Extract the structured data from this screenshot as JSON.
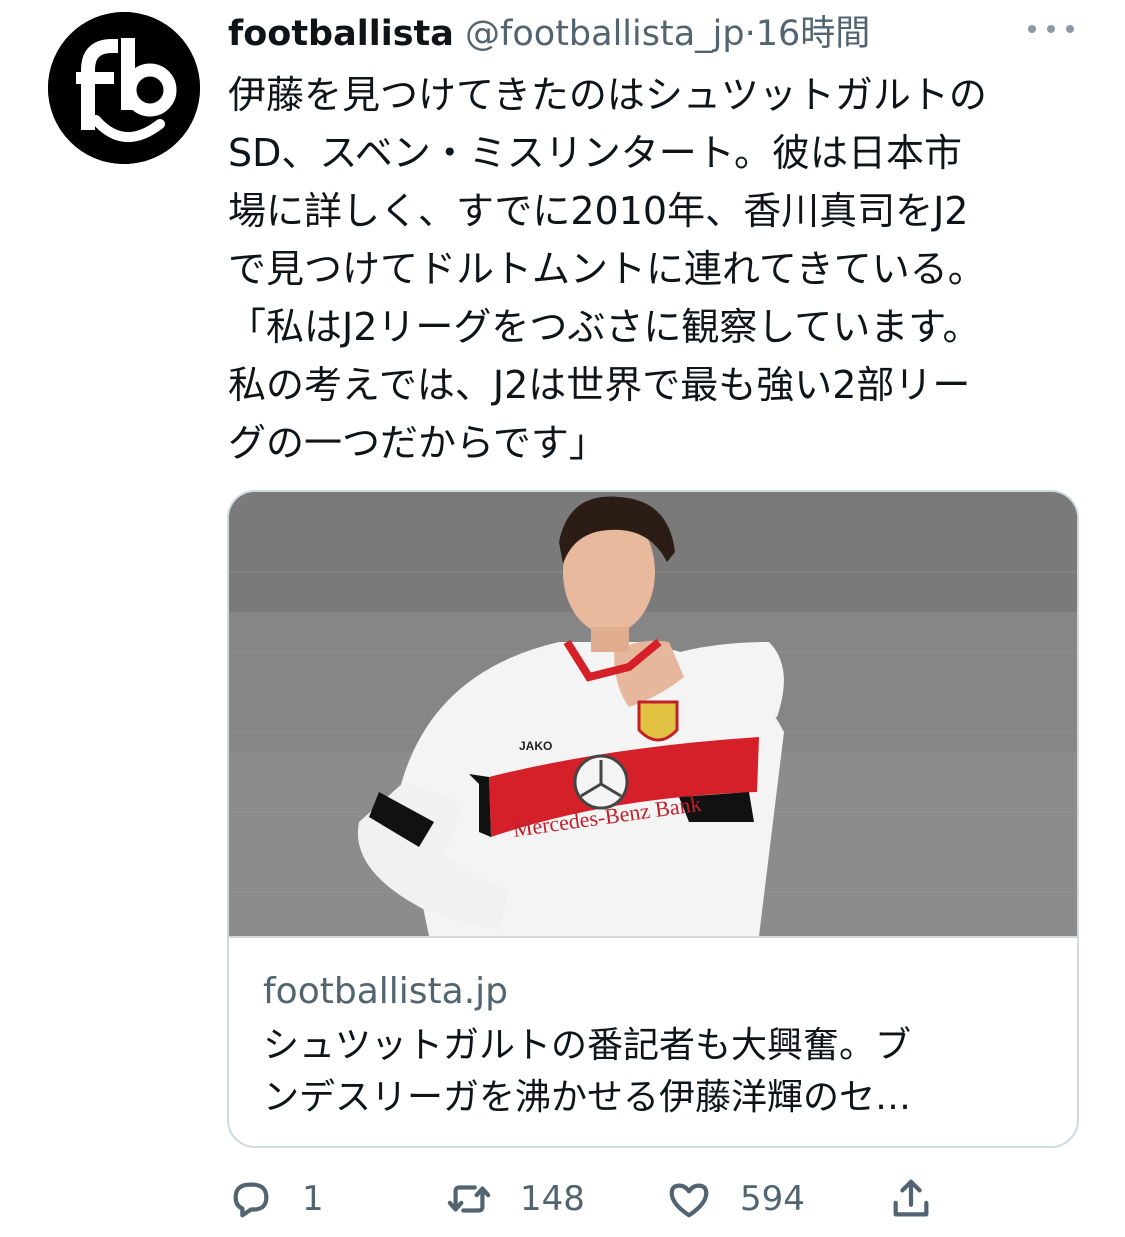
{
  "tweet": {
    "author_name": "footballista",
    "handle": "@footballista_jp",
    "separator": "·",
    "time": "16時間",
    "text_lines": [
      "伊藤を見つけてきたのはシュツットガルトの",
      "SD、スベン・ミスリンタート。彼は日本市",
      "場に詳しく、すでに2010年、香川真司をJ2",
      "で見つけてドルトムントに連れてきている。",
      "「私はJ2リーグをつぶさに観察しています。",
      "私の考えでは、J2は世界で最も強い2部リー",
      "グの一つだからです」"
    ]
  },
  "card": {
    "image_icon": "photo-player",
    "image_text": {
      "sponsor": "Mercedes-Benz Bank",
      "kit_brand": "JAKO"
    },
    "domain": "footballista.jp",
    "title_lines": [
      "シュツットガルトの番記者も大興奮。ブ",
      "ンデスリーガを沸かせる伊藤洋輝のセ…"
    ]
  },
  "actions": {
    "reply": {
      "icon": "reply-icon",
      "count": "1"
    },
    "retweet": {
      "icon": "retweet-icon",
      "count": "148"
    },
    "like": {
      "icon": "heart-icon",
      "count": "594"
    },
    "share": {
      "icon": "share-icon"
    }
  },
  "colors": {
    "secondary_text": "#536471",
    "border": "#cfd9de",
    "avatar_bg": "#000000"
  }
}
